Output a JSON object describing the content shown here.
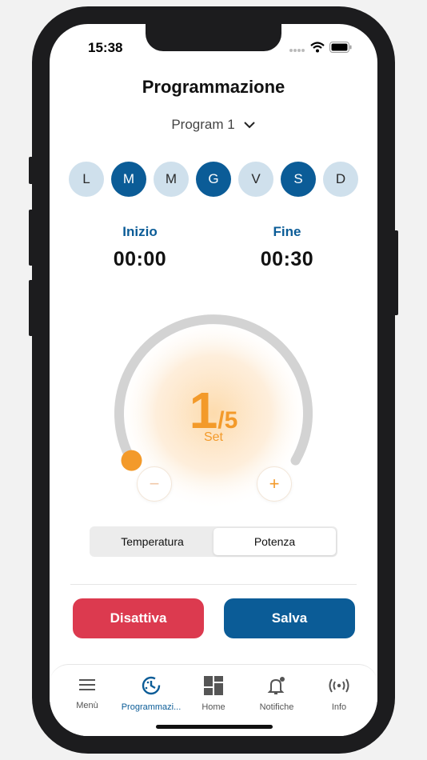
{
  "status_bar": {
    "time": "15:38"
  },
  "header": {
    "title": "Programmazione"
  },
  "program_select": {
    "value": "Program 1"
  },
  "days": [
    {
      "label": "L",
      "active": false
    },
    {
      "label": "M",
      "active": true
    },
    {
      "label": "M",
      "active": false
    },
    {
      "label": "G",
      "active": true
    },
    {
      "label": "V",
      "active": false
    },
    {
      "label": "S",
      "active": true
    },
    {
      "label": "D",
      "active": false
    }
  ],
  "schedule": {
    "start_label": "Inizio",
    "start_value": "00:00",
    "end_label": "Fine",
    "end_value": "00:30"
  },
  "dial": {
    "value": "1",
    "max": "/5",
    "sub": "Set",
    "level": 0.2,
    "minus_label": "−",
    "plus_label": "+"
  },
  "mode_toggle": {
    "options": [
      "Temperatura",
      "Potenza"
    ],
    "selected": "Potenza"
  },
  "actions": {
    "deactivate_label": "Disattiva",
    "save_label": "Salva"
  },
  "tabbar": {
    "items": [
      {
        "label": "Menù",
        "icon": "menu-icon"
      },
      {
        "label": "Programmazi...",
        "icon": "schedule-icon",
        "active": true
      },
      {
        "label": "Home",
        "icon": "grid-icon"
      },
      {
        "label": "Notifiche",
        "icon": "bell-icon"
      },
      {
        "label": "Info",
        "icon": "signal-icon"
      }
    ]
  },
  "colors": {
    "primary": "#0b5c97",
    "day_inactive": "#cfe0ec",
    "accent": "#f39a2a",
    "danger": "#dc3a4f"
  }
}
